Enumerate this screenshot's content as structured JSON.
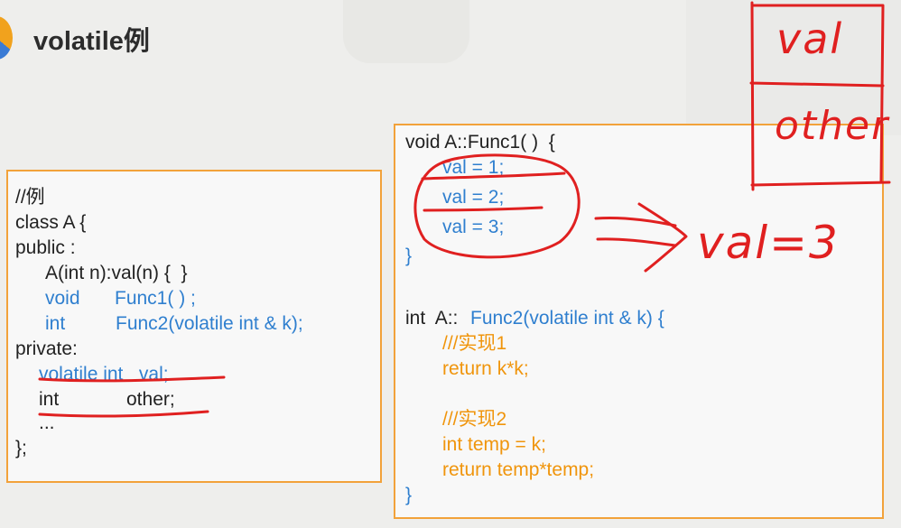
{
  "slide": {
    "title": "volatile例"
  },
  "left_code": {
    "lines": [
      "//例",
      "class A {",
      "public :",
      "A(int n):val(n) {  }",
      "void",
      "Func1( ) ;",
      "int",
      "Func2(volatile int & k);",
      "private:",
      "volatile int   val;",
      "int",
      "other;",
      "...",
      "};"
    ]
  },
  "right_code": {
    "lines": [
      "void A::Func1( )  {",
      "val = 1;",
      "val = 2;",
      "val = 3;",
      "}",
      "int  A::",
      "Func2(volatile int & k) {",
      "///实现1",
      "return k*k;",
      "///实现2",
      "int temp = k;",
      "return temp*temp;",
      "}"
    ]
  },
  "annotations": {
    "memory_cells": [
      "val",
      "other"
    ],
    "result_note": "val=3",
    "ink_color": "#e02020"
  },
  "colors": {
    "keyword_blue": "#2f7fcf",
    "impl_orange": "#f0950c",
    "box_border": "#f2a23a"
  }
}
